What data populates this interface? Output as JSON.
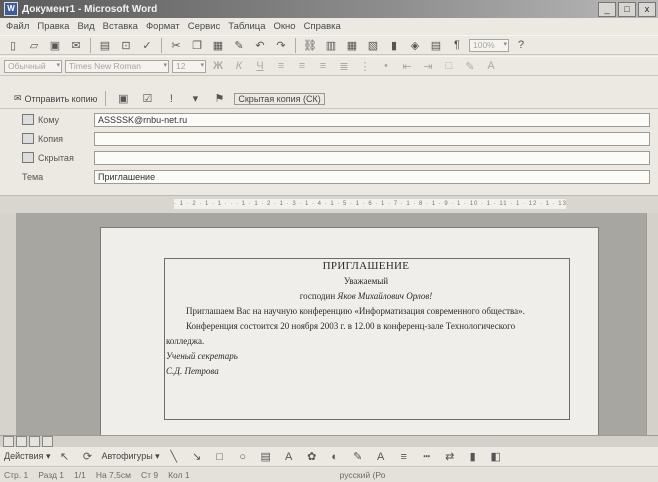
{
  "window": {
    "title": "Документ1 - Microsoft Word",
    "controls": [
      "_",
      "□",
      "x"
    ]
  },
  "menu": [
    "Файл",
    "Правка",
    "Вид",
    "Вставка",
    "Формат",
    "Сервис",
    "Таблица",
    "Окно",
    "Справка"
  ],
  "format_toolbar": {
    "style": "Обычный",
    "font": "Times New Roman",
    "size": "12"
  },
  "mail": {
    "send_label": "Отправить копию",
    "bcc_button": "Скрытая копия (СК)",
    "fields": [
      {
        "label": "Кому",
        "value": "ASSSSK@rnbu-net.ru"
      },
      {
        "label": "Копия",
        "value": ""
      },
      {
        "label": "Скрытая",
        "value": ""
      },
      {
        "label": "Тема",
        "value": "Приглашение"
      }
    ]
  },
  "ruler": {
    "scale": "· 1 · 2 · 1 · 1 · · · 1 · 1 · 2 · 1 · 3 · 1 · 4 · 1 · 5 · 1 · 6 · 1 · 7 · 1 · 8 · 1 · 9 · 1 · 10 · 1 · 11 · 1 · 12 · 1 · 13 · 1 · 14 · 1 · 15 · 1 · 16 ·"
  },
  "document": {
    "heading": "ПРИГЛАШЕНИЕ",
    "salutation": "Уважаемый",
    "addressee_prefix": "господин",
    "addressee_name": "Яков Михайлович Орлов!",
    "para1": "Приглашаем Вас на научную конференцию «Информатизация современного общества».",
    "para2": "Конференция состоится 20 ноября 2003 г. в 12.00 в конференц-зале Технологического",
    "para2_cont": "колледжа.",
    "sign_title": "Ученый секретарь",
    "sign_name": "С.Д. Петрова"
  },
  "drawing": {
    "actions": "Действия",
    "autoshapes": "Автофигуры"
  },
  "status": {
    "page": "Стр. 1",
    "section": "Разд 1",
    "pages": "1/1",
    "position": "На 7,5см",
    "line": "Ст 9",
    "column": "Кол 1",
    "language": "русский (Ро"
  }
}
